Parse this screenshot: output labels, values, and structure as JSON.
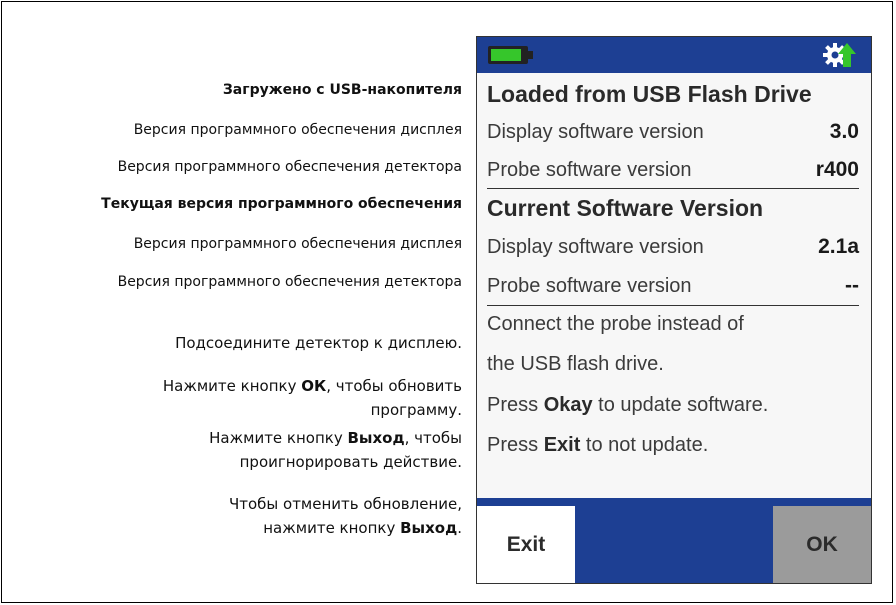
{
  "annotations": {
    "loaded_heading": "Загружено с USB-накопителя",
    "loaded_display": "Версия программного обеспечения дисплея",
    "loaded_probe": "Версия программного обеспечения детектора",
    "current_heading": "Текущая версия программного обеспечения",
    "current_display": "Версия программного обеспечения дисплея",
    "current_probe": "Версия программного обеспечения детектора",
    "connect": "Подсоедините детектор к дисплею.",
    "ok_line1_a": "Нажмите кнопку ",
    "ok_line1_b": "ОК",
    "ok_line1_c": ", чтобы обновить",
    "ok_line2": "программу.",
    "exit_line1_a": "Нажмите кнопку ",
    "exit_line1_b": "Выход",
    "exit_line1_c": ", чтобы",
    "exit_line2": "проигнорировать действие.",
    "cancel_line1": "Чтобы отменить обновление,",
    "cancel_line2_a": "нажмите кнопку ",
    "cancel_line2_b": "Выход",
    "cancel_line2_c": "."
  },
  "screen": {
    "status": {
      "battery_icon": "battery-full-icon",
      "update_icon": "gear-update-icon",
      "accent_color": "#1d3f93",
      "battery_color": "#36c62b"
    },
    "loaded": {
      "title": "Loaded from USB Flash Drive",
      "display_label": "Display software version",
      "display_value": "3.0",
      "probe_label": "Probe software version",
      "probe_value": "r400"
    },
    "current": {
      "title": "Current Software Version",
      "display_label": "Display software version",
      "display_value": "2.1a",
      "probe_label": "Probe software version",
      "probe_value": "--"
    },
    "message": {
      "line1": "Connect the probe instead of",
      "line2": "the USB flash drive.",
      "okay_a": "Press ",
      "okay_b": "Okay",
      "okay_c": " to update software.",
      "exit_a": "Press ",
      "exit_b": "Exit",
      "exit_c": " to not update."
    },
    "buttons": {
      "exit_label": "Exit",
      "ok_label": "OK"
    }
  }
}
